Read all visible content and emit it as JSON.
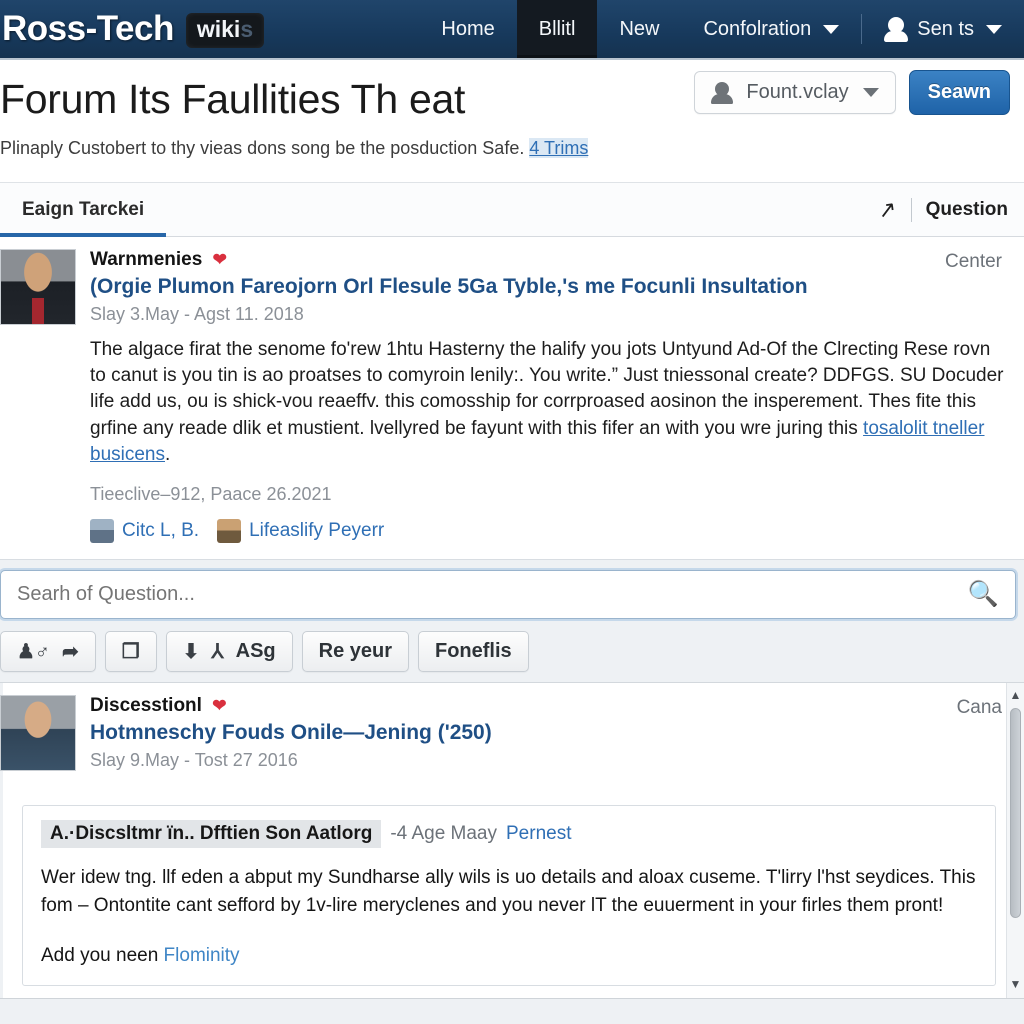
{
  "navbar": {
    "brand": "Ross-Tech",
    "brand_badge": "wiki",
    "brand_badge_faint": "s",
    "items": [
      {
        "label": "Home",
        "active": false
      },
      {
        "label": "Bllitl",
        "active": true
      },
      {
        "label": "New",
        "active": false
      },
      {
        "label": "Confolration",
        "active": false,
        "caret": true
      }
    ],
    "user": {
      "label": "Sen ts",
      "caret": true
    }
  },
  "header": {
    "title": "Forum Its Faullities Th eat",
    "subtitle_before": "Plinaply Custobert to thy vieas dons song be the posduction Safe.",
    "subtitle_link": "4 Trims",
    "dropdown_label": "Fount.vclay",
    "primary_button": "Seawn"
  },
  "tabs": {
    "items": [
      {
        "label": "Eaign Tarckei",
        "active": true
      }
    ],
    "right_label": "Question",
    "right_icon": "trending-arrow-icon"
  },
  "post1": {
    "kind": "Warnmenies",
    "title": "(Orgie Plumon Fareojorn Orl Flesule 5Ga Tyble,'s me Focunli Insultation",
    "meta": "Slay 3.May - Agst 11. 2018",
    "corner_label": "Center",
    "body_before": "The algace firat the senome fo'rew 1htu Hasterny the halify you jots Untyund Ad-Of the Clrecting Rese rovn to canut is you tin is ao proatses to comyroin lenily:. You write.” Just tniessonal create? DDFGS. SU Docuder life add us, ou is shick-vou reaeffv. this comosship for corrproased aosinon the insperement. Thes fite this grfine any reade dlik et mustient. lvellyred be fayunt with this fifer an with you wre juring this ",
    "body_link": "tosalolit tneller busicens",
    "body_after": ".",
    "footer_date": "Tieeclive–912, Paace 26.2021",
    "commenters": [
      "Citc L, B.",
      "Lifeaslify Peyerr"
    ]
  },
  "search": {
    "placeholder": "Searh of Question...",
    "value": "",
    "icon": "search-icon"
  },
  "toolbar": {
    "buttons": [
      {
        "name": "people-pin-button",
        "icons": [
          "♟♀",
          "⚑"
        ],
        "label": ""
      },
      {
        "name": "copy-pages-button",
        "icons": [
          "❐"
        ],
        "label": ""
      },
      {
        "name": "download-filter-button",
        "icons": [
          "⬇",
          "⅄"
        ],
        "label": "ASg"
      },
      {
        "name": "re-yeur-button",
        "icons": [],
        "label": "Re yeur"
      },
      {
        "name": "foneflis-button",
        "icons": [],
        "label": "Foneflis"
      }
    ]
  },
  "post2": {
    "kind": "Discesstionl",
    "title": "Hotmneschy Fouds Onile—Jening ('250)",
    "meta": "Slay 9.May - Tost 27 2016",
    "corner_label": "Cana",
    "quote": {
      "chip": "A.·Discsltmr ïn.. Dfftien Son Aatlorg",
      "age": "-4 Age Maay",
      "link": "Pernest",
      "text": "Wer idew tng. llf eden a abput my Sundharse ally wils is uo details and aloax cuseme.  T'lirry l'hst seydices. This fom – Ontontite cant sefford by 1v-lire meryclenes and you never lT the euuerment in your firles them prontǃ",
      "footer_before": "Add you neen ",
      "footer_link": "Flominity"
    }
  },
  "colors": {
    "navbar": "#17395c",
    "accent": "#2766a8",
    "link": "#2f6fb5",
    "heart": "#d9303e",
    "page_bg": "#eef1f4"
  }
}
